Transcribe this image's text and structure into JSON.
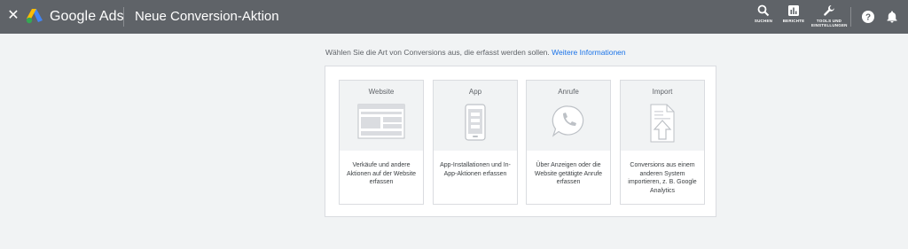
{
  "header": {
    "close_icon": "close-icon",
    "brand": "Google Ads",
    "title": "Neue Conversion-Aktion",
    "tools": [
      {
        "id": "search",
        "icon": "search-icon",
        "label": "SUCHEN"
      },
      {
        "id": "reports",
        "icon": "bar-chart-icon",
        "label": "BERICHTE"
      },
      {
        "id": "tools",
        "icon": "wrench-icon",
        "label": "TOOLS UND\nEINSTELLUNGEN"
      }
    ],
    "help_icon": "help-icon",
    "notifications_icon": "bell-icon"
  },
  "main": {
    "intro_text": "Wählen Sie die Art von Conversions aus, die erfasst werden sollen.",
    "intro_link": "Weitere Informationen",
    "cards": [
      {
        "title": "Website",
        "icon": "website-illustration",
        "description": "Verkäufe und andere Aktionen auf der Website erfassen"
      },
      {
        "title": "App",
        "icon": "phone-illustration",
        "description": "App-Installationen und In-App-Aktionen erfassen"
      },
      {
        "title": "Anrufe",
        "icon": "phone-call-illustration",
        "description": "Über Anzeigen oder die Website getätigte Anrufe erfassen"
      },
      {
        "title": "Import",
        "icon": "import-document-illustration",
        "description": "Conversions aus einem anderen System importieren, z. B. Google Analytics"
      }
    ]
  },
  "colors": {
    "header_bg": "#5f6368",
    "page_bg": "#f1f3f4",
    "link": "#1a73e8",
    "card_top_bg": "#f1f3f4",
    "border": "#dadce0"
  }
}
